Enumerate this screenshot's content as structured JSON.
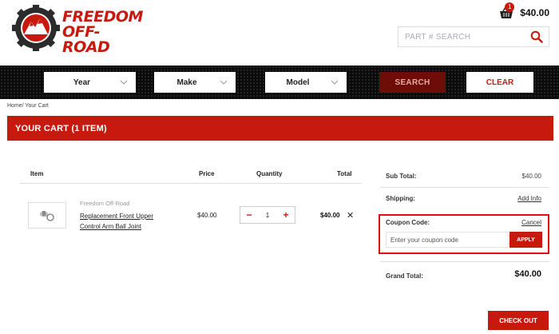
{
  "header": {
    "logo_line1": "FREEDOM",
    "logo_line2": "OFF-ROAD",
    "cart_count": "1",
    "cart_total": "$40.00",
    "search_placeholder": "PART # SEARCH"
  },
  "filters": {
    "year_label": "Year",
    "make_label": "Make",
    "model_label": "Model",
    "search_label": "SEARCH",
    "clear_label": "CLEAR"
  },
  "breadcrumb": "Home/ Your Cart",
  "cart_title": "YOUR CART (1 ITEM)",
  "table": {
    "headers": {
      "item": "Item",
      "price": "Price",
      "quantity": "Quantity",
      "total": "Total"
    },
    "rows": [
      {
        "brand": "Freedom Off-Road",
        "name": "Replacement Front Upper Control Arm Ball Joint",
        "price": "$40.00",
        "quantity": "1",
        "total": "$40.00"
      }
    ]
  },
  "summary": {
    "subtotal_label": "Sub Total:",
    "subtotal_value": "$40.00",
    "shipping_label": "Shipping:",
    "shipping_link": "Add Info",
    "coupon_label": "Coupon Code:",
    "coupon_cancel": "Cancel",
    "coupon_placeholder": "Enter your coupon code",
    "apply_label": "APPLY",
    "grand_total_label": "Grand Total:",
    "grand_total_value": "$40.00"
  },
  "checkout_label": "CHECK OUT",
  "colors": {
    "brand_red": "#c8190f",
    "dark_red": "#6e0c08",
    "highlight": "#e01010"
  },
  "icons": [
    "logo-gear-mountain",
    "basket-icon",
    "search-icon",
    "chevron-down-icon",
    "close-icon",
    "minus-icon",
    "plus-icon"
  ]
}
